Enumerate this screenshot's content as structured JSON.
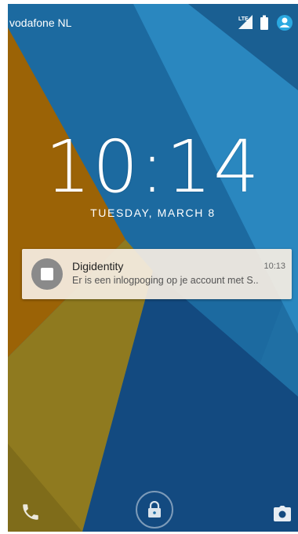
{
  "status_bar": {
    "carrier": "vodafone NL",
    "network_type": "LTE",
    "icons": [
      "signal-icon",
      "battery-icon",
      "account-icon"
    ],
    "accent_color": "#2aa8e0"
  },
  "lockscreen": {
    "time": "10:14",
    "date": "TUESDAY, MARCH 8"
  },
  "notification": {
    "app_name": "Digidentity",
    "time": "10:13",
    "text": "Er is een inlogpoging op je account met S..",
    "icon": "app-square-icon"
  },
  "bottom_actions": {
    "left": "phone-icon",
    "center": "lock-icon",
    "right": "camera-icon"
  },
  "wallpaper_colors": {
    "blue_light": "#2a87bf",
    "blue_mid": "#1f6fa4",
    "blue_dark": "#134a80",
    "orange": "#9b6306",
    "olive": "#8f7a1f"
  }
}
